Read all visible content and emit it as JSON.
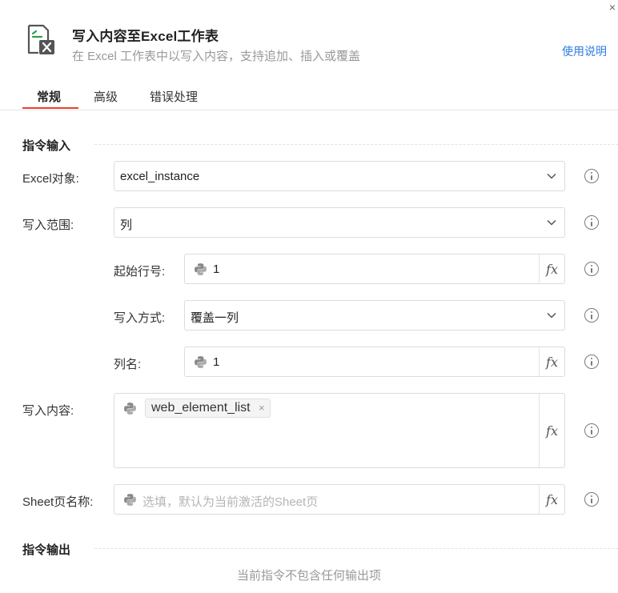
{
  "header": {
    "title": "写入内容至Excel工作表",
    "description": "在 Excel 工作表中以写入内容，支持追加、插入或覆盖",
    "help_link": "使用说明"
  },
  "tabs": [
    {
      "label": "常规",
      "active": true
    },
    {
      "label": "高级",
      "active": false
    },
    {
      "label": "错误处理",
      "active": false
    }
  ],
  "sections": {
    "input_title": "指令输入",
    "output_title": "指令输出",
    "no_output_text": "当前指令不包含任何输出项"
  },
  "fields": {
    "excel_object": {
      "label": "Excel对象:",
      "value": "excel_instance"
    },
    "write_range": {
      "label": "写入范围:",
      "value": "列"
    },
    "start_row": {
      "label": "起始行号:",
      "value": "1"
    },
    "write_mode": {
      "label": "写入方式:",
      "value": "覆盖一列"
    },
    "column_name": {
      "label": "列名:",
      "value": "1"
    },
    "write_content": {
      "label": "写入内容:",
      "tag": "web_element_list",
      "tag_close": "×"
    },
    "sheet_name": {
      "label": "Sheet页名称:",
      "placeholder": "选填，默认为当前激活的Sheet页"
    }
  },
  "fx_label": "fx",
  "close_glyph": "×",
  "icons": {
    "header": "excel-document-icon",
    "python": "python-icon",
    "info": "info-icon",
    "chevron": "chevron-down-icon"
  },
  "colors": {
    "accent_tab": "#e8412c",
    "link": "#2f7de1",
    "excel_green": "#2e9e4e"
  }
}
